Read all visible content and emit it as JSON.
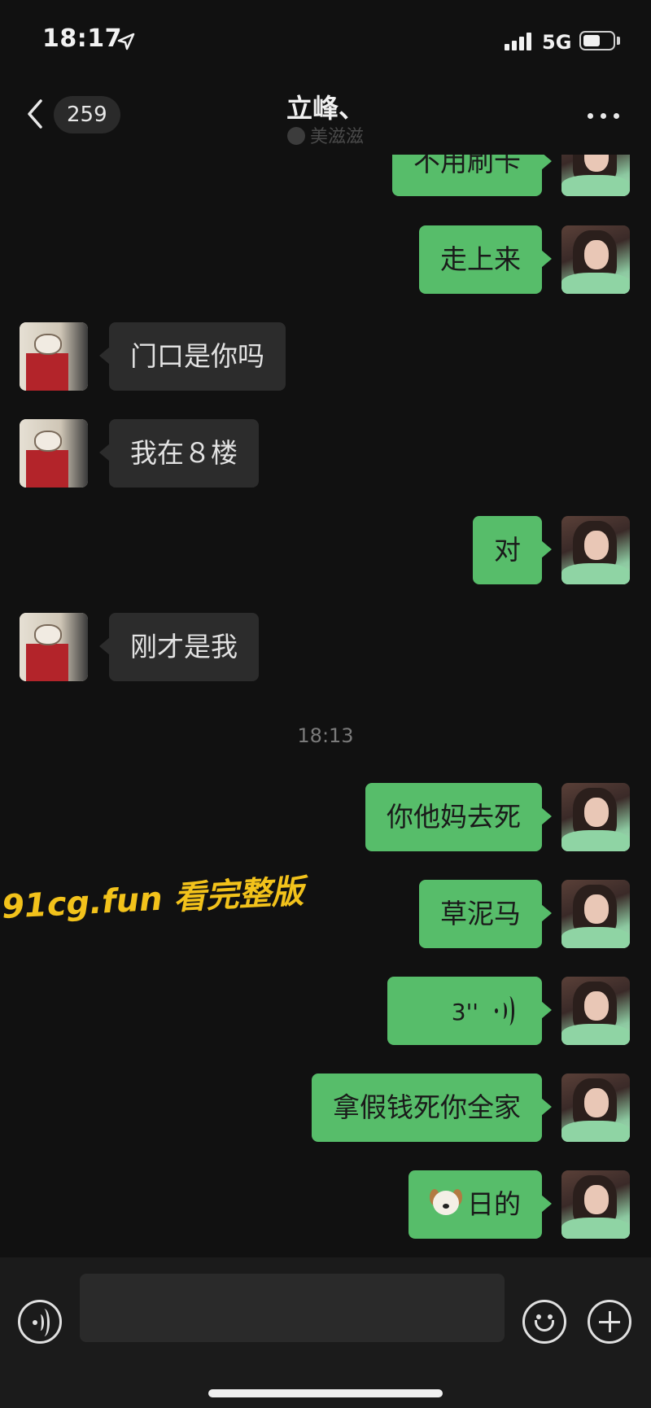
{
  "status_bar": {
    "time": "18:17",
    "network": "5G",
    "battery_level": 0.55,
    "icons": [
      "location-arrow-icon",
      "signal-bars-icon",
      "battery-icon"
    ]
  },
  "nav": {
    "unread_count": "259",
    "title": "立峰、",
    "subtitle": "美滋滋",
    "icons": [
      "back-chevron-icon",
      "more-dots-icon"
    ]
  },
  "messages": [
    {
      "sender": "me",
      "type": "text",
      "text": "不用刷卡"
    },
    {
      "sender": "me",
      "type": "text",
      "text": "走上来"
    },
    {
      "sender": "them",
      "type": "text",
      "text": "门口是你吗"
    },
    {
      "sender": "them",
      "type": "text",
      "text": "我在８楼"
    },
    {
      "sender": "me",
      "type": "text",
      "text": "对"
    },
    {
      "sender": "them",
      "type": "text",
      "text": "刚才是我"
    },
    {
      "type": "timestamp",
      "text": "18:13"
    },
    {
      "sender": "me",
      "type": "text",
      "text": "你他妈去死"
    },
    {
      "sender": "me",
      "type": "text",
      "text": "草泥马"
    },
    {
      "sender": "me",
      "type": "voice",
      "duration": "3''"
    },
    {
      "sender": "me",
      "type": "text",
      "text": "拿假钱死你全家"
    },
    {
      "sender": "me",
      "type": "emoji_text",
      "emoji": "dog-face-icon",
      "text": "日的"
    }
  ],
  "watermark": "91cg.fun 看完整版",
  "input_bar": {
    "value": "",
    "icons": [
      "voice-toggle-icon",
      "emoji-icon",
      "plus-icon"
    ]
  },
  "colors": {
    "background": "#111111",
    "my_bubble": "#57bd6a",
    "their_bubble": "#2c2c2c",
    "watermark": "#f2c21b"
  }
}
